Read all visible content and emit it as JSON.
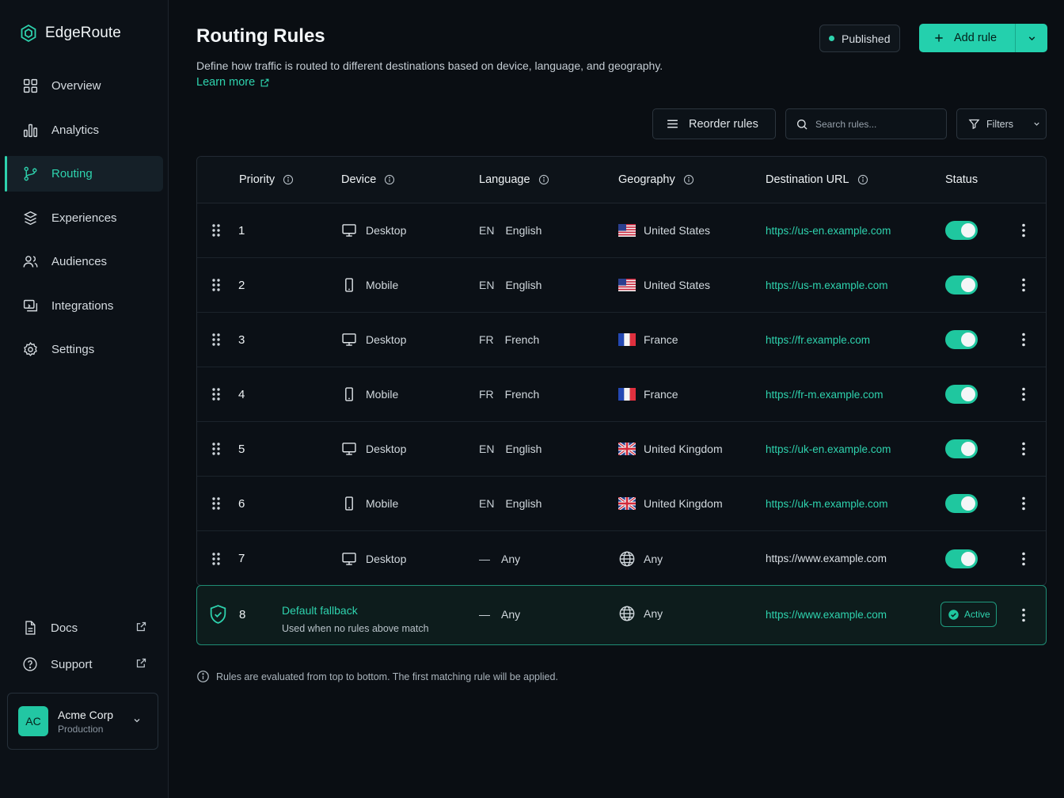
{
  "app": {
    "name": "EdgeRoute"
  },
  "sidebar": {
    "items": [
      {
        "label": "Overview",
        "icon": "grid-icon",
        "active": false
      },
      {
        "label": "Analytics",
        "icon": "bar-chart-icon",
        "active": false
      },
      {
        "label": "Routing",
        "icon": "git-branch-icon",
        "active": true
      },
      {
        "label": "Experiences",
        "icon": "layers-icon",
        "active": false
      },
      {
        "label": "Audiences",
        "icon": "users-icon",
        "active": false
      },
      {
        "label": "Integrations",
        "icon": "integrations-icon",
        "active": false
      },
      {
        "label": "Settings",
        "icon": "gear-icon",
        "active": false
      }
    ],
    "bottom": [
      {
        "label": "Docs",
        "icon": "document-icon"
      },
      {
        "label": "Support",
        "icon": "help-icon"
      }
    ],
    "account": {
      "initials": "AC",
      "name": "Acme Corp",
      "env": "Production"
    }
  },
  "header": {
    "title": "Routing Rules",
    "subtitle": "Define how traffic is routed to different destinations based on device, language, and geography.",
    "learn_more": "Learn more",
    "status": "Published",
    "add_rule": "Add rule"
  },
  "toolbar": {
    "reorder": "Reorder rules",
    "search_placeholder": "Search rules...",
    "filters": "Filters"
  },
  "table": {
    "columns": [
      "Priority",
      "Device",
      "Language",
      "Geography",
      "Destination URL",
      "Status"
    ],
    "rows": [
      {
        "priority": "1",
        "device": "Desktop",
        "lang_code": "EN",
        "lang": "English",
        "geo": "United States",
        "flag": "us",
        "url": "https://us-en.example.com",
        "enabled": true
      },
      {
        "priority": "2",
        "device": "Mobile",
        "lang_code": "EN",
        "lang": "English",
        "geo": "United States",
        "flag": "us",
        "url": "https://us-m.example.com",
        "enabled": true
      },
      {
        "priority": "3",
        "device": "Desktop",
        "lang_code": "FR",
        "lang": "French",
        "geo": "France",
        "flag": "fr",
        "url": "https://fr.example.com",
        "enabled": true
      },
      {
        "priority": "4",
        "device": "Mobile",
        "lang_code": "FR",
        "lang": "French",
        "geo": "France",
        "flag": "fr",
        "url": "https://fr-m.example.com",
        "enabled": true
      },
      {
        "priority": "5",
        "device": "Desktop",
        "lang_code": "EN",
        "lang": "English",
        "geo": "United Kingdom",
        "flag": "uk",
        "url": "https://uk-en.example.com",
        "enabled": true
      },
      {
        "priority": "6",
        "device": "Mobile",
        "lang_code": "EN",
        "lang": "English",
        "geo": "United Kingdom",
        "flag": "uk",
        "url": "https://uk-m.example.com",
        "enabled": true
      },
      {
        "priority": "7",
        "device": "Desktop",
        "lang_code": "—",
        "lang": "Any",
        "geo": "Any",
        "flag": "globe",
        "url": "https://www.example.com",
        "enabled": true
      }
    ],
    "fallback": {
      "priority": "8",
      "title": "Default fallback",
      "subtitle": "Used when no rules above match",
      "lang_code": "—",
      "lang": "Any",
      "geo": "Any",
      "url": "https://www.example.com",
      "status": "Active"
    }
  },
  "footnote": "Rules are evaluated from top to bottom. The first matching rule will be applied.",
  "colors": {
    "accent": "#2ed3ae",
    "background": "#0a0e13",
    "toggle_on": "#1fc79f"
  }
}
